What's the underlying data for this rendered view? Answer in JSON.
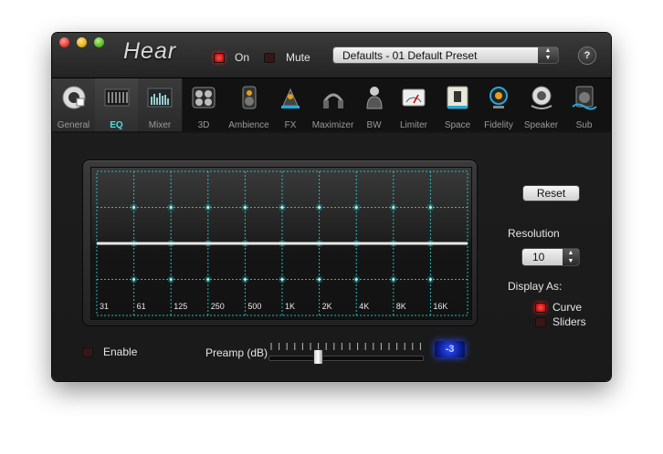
{
  "app": {
    "logo": "Hear"
  },
  "header": {
    "on_label": "On",
    "on_state": true,
    "mute_label": "Mute",
    "mute_state": false,
    "preset": "Defaults - 01 Default Preset",
    "help_label": "?"
  },
  "tabs": [
    {
      "label": "General",
      "icon": "speaker-knob-icon",
      "selected": false
    },
    {
      "label": "EQ",
      "icon": "equalizer-icon",
      "selected": true
    },
    {
      "label": "Mixer",
      "icon": "mixer-icon",
      "selected": false
    },
    {
      "label": "3D",
      "icon": "3d-speakers-icon",
      "selected": false
    },
    {
      "label": "Ambience",
      "icon": "ambience-speaker-icon",
      "selected": false
    },
    {
      "label": "FX",
      "icon": "fx-speaker-icon",
      "selected": false
    },
    {
      "label": "Maximizer",
      "icon": "maximizer-icon",
      "selected": false
    },
    {
      "label": "BW",
      "icon": "bw-figure-icon",
      "selected": false
    },
    {
      "label": "Limiter",
      "icon": "limiter-meter-icon",
      "selected": false
    },
    {
      "label": "Space",
      "icon": "space-speaker-icon",
      "selected": false
    },
    {
      "label": "Fidelity",
      "icon": "fidelity-icon",
      "selected": false
    },
    {
      "label": "Speaker",
      "icon": "speaker-cone-icon",
      "selected": false
    },
    {
      "label": "Sub",
      "icon": "subwoofer-icon",
      "selected": false
    }
  ],
  "eq": {
    "bands": [
      "31",
      "61",
      "125",
      "250",
      "500",
      "1K",
      "2K",
      "4K",
      "8K",
      "16K"
    ],
    "gains_db": [
      0,
      0,
      0,
      0,
      0,
      0,
      0,
      0,
      0,
      0
    ]
  },
  "controls": {
    "reset_label": "Reset",
    "resolution_label": "Resolution",
    "resolution_value": "10",
    "display_as_label": "Display As:",
    "curve_label": "Curve",
    "curve_selected": true,
    "sliders_label": "Sliders",
    "sliders_selected": false
  },
  "footer": {
    "enable_label": "Enable",
    "enable_state": false,
    "preamp_label": "Preamp (dB)",
    "preamp_value": "-3",
    "preamp_position": 0.32
  },
  "colors": {
    "grid": "#24d6d6",
    "led_on": "#ff3030",
    "lcd": "#2a4cff"
  }
}
